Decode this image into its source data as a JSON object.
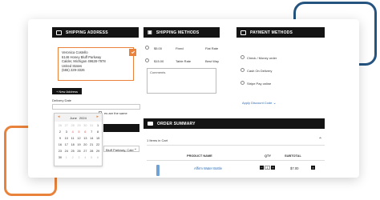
{
  "shipping_address": {
    "title": "SHIPPING ADDRESS",
    "lines": [
      "Veronica Costello",
      "6146 Honey Bluff Parkway",
      "Calder, Michigan 49628-7978",
      "United States",
      "(555) 229-3326"
    ],
    "new_address_label": "+ New Address",
    "delivery_date_label": "Delivery Date",
    "peek_text": "es are the same",
    "peek_address": "Bluff Parkway, Cald",
    "peek_chevron": "⌄"
  },
  "calendar": {
    "month": "June",
    "year": "2024",
    "prev": "◂",
    "next": "▸",
    "days": [
      [
        "26",
        "27",
        "28",
        "29",
        "30",
        "31",
        "1"
      ],
      [
        "2",
        "3",
        "4",
        "5",
        "6",
        "7",
        "8"
      ],
      [
        "9",
        "10",
        "11",
        "12",
        "13",
        "14",
        "15"
      ],
      [
        "16",
        "17",
        "18",
        "19",
        "20",
        "21",
        "22"
      ],
      [
        "23",
        "24",
        "25",
        "26",
        "27",
        "28",
        "29"
      ],
      [
        "30",
        "1",
        "2",
        "3",
        "4",
        "5",
        "6"
      ]
    ]
  },
  "shipping_methods": {
    "title": "SHIPPING METHODS",
    "options": [
      {
        "price": "$5.00",
        "method": "Fixed",
        "carrier": "Flat Rate"
      },
      {
        "price": "$15.00",
        "method": "Table Rate",
        "carrier": "Best Way"
      }
    ],
    "comments_label": "Comments"
  },
  "payment_methods": {
    "title": "PAYMENT METHODS",
    "options": [
      "Check / Money order",
      "Cash On Delivery",
      "Stripe Pay online"
    ],
    "discount_label": "Apply Discount Code",
    "discount_chevron": "⌄"
  },
  "order_summary": {
    "title": "ORDER SUMMARY",
    "items_in_cart": "1 Items in Cart",
    "collapse_chevron": "⌃",
    "columns": [
      "PRODUCT NAME",
      "QTY",
      "SUBTOTAL"
    ],
    "product": {
      "name": "Affirm Water Bottle",
      "qty": "1",
      "subtotal": "$7.00"
    },
    "minus": "−",
    "plus": "+",
    "remove": "×"
  },
  "colors": {
    "accent": "#e9833c",
    "dark": "#141414",
    "link": "#2f6db5",
    "deco_blue": "#24547f"
  }
}
